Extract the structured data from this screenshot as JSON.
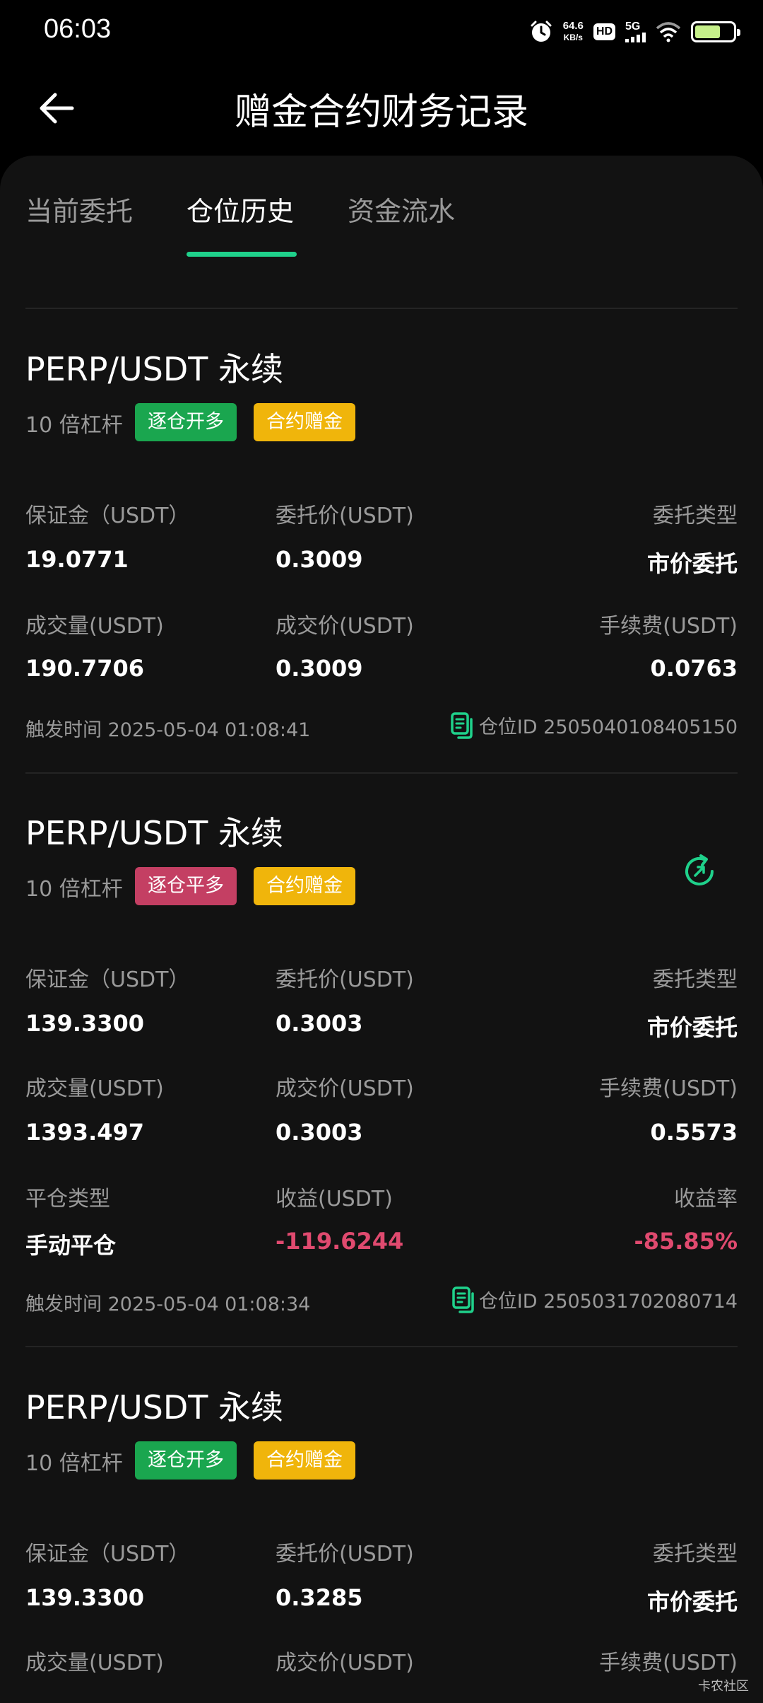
{
  "status_bar": {
    "time": "06:03",
    "net_speed_value": "64.6",
    "net_speed_unit": "KB/s",
    "hd": "HD",
    "network": "5G",
    "battery_level": 0.68
  },
  "header": {
    "title": "赠金合约财务记录"
  },
  "tabs": [
    {
      "label": "当前委托"
    },
    {
      "label": "仓位历史"
    },
    {
      "label": "资金流水"
    }
  ],
  "active_tab": "仓位历史",
  "labels": {
    "margin": "保证金（USDT）",
    "order_price": "委托价(USDT)",
    "order_type": "委托类型",
    "filled_qty": "成交量(USDT)",
    "filled_price": "成交价(USDT)",
    "fee": "手续费(USDT)",
    "close_type": "平仓类型",
    "pnl": "收益(USDT)",
    "pnl_rate": "收益率"
  },
  "positions": [
    {
      "pair": "PERP/USDT 永续",
      "leverage": "10 倍杠杆",
      "tag_side": "逐仓开多",
      "tag_bonus": "合约赠金",
      "margin": "19.0771",
      "order_price": "0.3009",
      "order_type": "市价委托",
      "filled_qty": "190.7706",
      "filled_price": "0.3009",
      "fee": "0.0763",
      "trigger_time": "触发时间 2025-05-04 01:08:41",
      "position_id": "仓位ID 2505040108405150"
    },
    {
      "pair": "PERP/USDT 永续",
      "leverage": "10 倍杠杆",
      "tag_side": "逐仓平多",
      "tag_bonus": "合约赠金",
      "margin": "139.3300",
      "order_price": "0.3003",
      "order_type": "市价委托",
      "filled_qty": "1393.497",
      "filled_price": "0.3003",
      "fee": "0.5573",
      "close_type": "手动平仓",
      "pnl": "-119.6244",
      "pnl_rate": "-85.85%",
      "trigger_time": "触发时间 2025-05-04 01:08:34",
      "position_id": "仓位ID 2505031702080714"
    },
    {
      "pair": "PERP/USDT 永续",
      "leverage": "10 倍杠杆",
      "tag_side": "逐仓开多",
      "tag_bonus": "合约赠金",
      "margin": "139.3300",
      "order_price": "0.3285",
      "order_type": "市价委托"
    }
  ],
  "watermark": "卡农社区",
  "colors": {
    "accent": "#1fd18b",
    "tag_open": "#1aa64f",
    "tag_close": "#c43f63",
    "tag_bonus": "#f0b50b",
    "negative": "#e04a6f"
  }
}
